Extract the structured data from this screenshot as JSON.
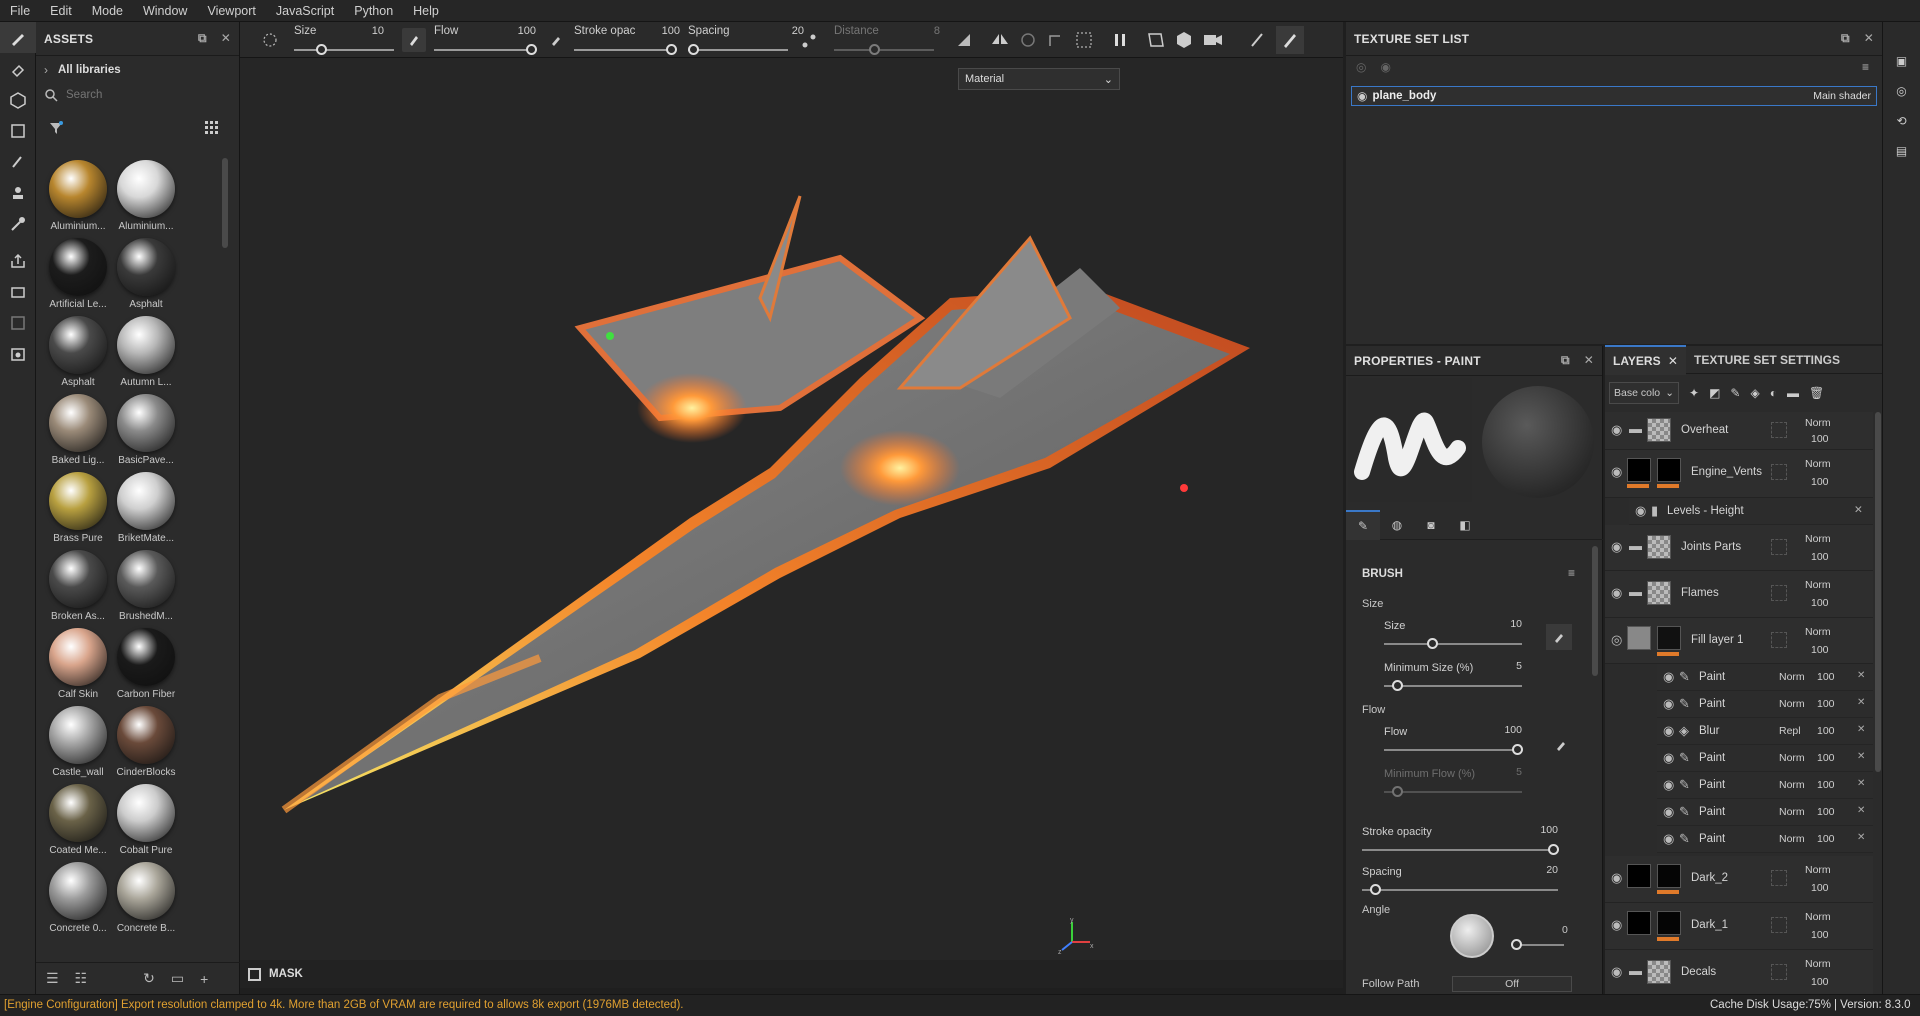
{
  "menu": [
    "File",
    "Edit",
    "Mode",
    "Window",
    "Viewport",
    "JavaScript",
    "Python",
    "Help"
  ],
  "assets": {
    "title": "ASSETS",
    "all_libraries": "All libraries",
    "search_placeholder": "Search",
    "materials": [
      {
        "name": "Aluminium...",
        "color": "#b8862e"
      },
      {
        "name": "Aluminium...",
        "color": "#d8d8d8"
      },
      {
        "name": "Artificial Le...",
        "color": "#1c1c1c"
      },
      {
        "name": "Asphalt",
        "color": "#3a3a3a"
      },
      {
        "name": "Asphalt",
        "color": "#4a4a4a"
      },
      {
        "name": "Autumn L...",
        "color": "#b8b8b8"
      },
      {
        "name": "Baked Lig...",
        "color": "#9a8a78"
      },
      {
        "name": "BasicPave...",
        "color": "#8a8a8a"
      },
      {
        "name": "Brass Pure",
        "color": "#b8a040"
      },
      {
        "name": "BriketMate...",
        "color": "#cfcfcf"
      },
      {
        "name": "Broken As...",
        "color": "#4a4a4a"
      },
      {
        "name": "BrushedM...",
        "color": "#5a5a5a"
      },
      {
        "name": "Calf Skin",
        "color": "#d9a58c"
      },
      {
        "name": "Carbon Fiber",
        "color": "#1a1a1a"
      },
      {
        "name": "Castle_wall",
        "color": "#a8a8a8"
      },
      {
        "name": "CinderBlocks",
        "color": "#6a4a3a"
      },
      {
        "name": "Coated Me...",
        "color": "#6a6248"
      },
      {
        "name": "Cobalt Pure",
        "color": "#cccccc"
      },
      {
        "name": "Concrete 0...",
        "color": "#9c9c9c"
      },
      {
        "name": "Concrete B...",
        "color": "#aaa69a"
      }
    ]
  },
  "toolbar": {
    "size_label": "Size",
    "size_value": "10",
    "flow_label": "Flow",
    "flow_value": "100",
    "stroke_label": "Stroke opac",
    "stroke_value": "100",
    "spacing_label": "Spacing",
    "spacing_value": "20",
    "distance_label": "Distance",
    "distance_value": "8"
  },
  "viewport": {
    "mode_select": "Material",
    "mask_label": "MASK"
  },
  "texture_set": {
    "title": "TEXTURE SET LIST",
    "item_name": "plane_body",
    "item_shader": "Main shader"
  },
  "properties": {
    "title": "PROPERTIES - PAINT",
    "brush_label": "BRUSH",
    "size_group": "Size",
    "size_label": "Size",
    "size_value": "10",
    "min_size_label": "Minimum Size (%)",
    "min_size_value": "5",
    "flow_group": "Flow",
    "flow_label": "Flow",
    "flow_value": "100",
    "min_flow_label": "Minimum Flow (%)",
    "min_flow_value": "5",
    "stroke_label": "Stroke opacity",
    "stroke_value": "100",
    "spacing_label": "Spacing",
    "spacing_value": "20",
    "angle_label": "Angle",
    "angle_value": "0",
    "follow_label": "Follow Path",
    "follow_value": "Off"
  },
  "layers": {
    "tab_layers": "LAYERS",
    "tab_settings": "TEXTURE SET SETTINGS",
    "channel": "Base colo",
    "items": [
      {
        "name": "Overheat",
        "blend": "Norm",
        "opacity": "100"
      },
      {
        "name": "Engine_Vents",
        "blend": "Norm",
        "opacity": "100"
      },
      {
        "name": "Levels - Height"
      },
      {
        "name": "Joints Parts",
        "blend": "Norm",
        "opacity": "100"
      },
      {
        "name": "Flames",
        "blend": "Norm",
        "opacity": "100"
      },
      {
        "name": "Fill layer 1",
        "blend": "Norm",
        "opacity": "100"
      },
      {
        "name": "Dark_2",
        "blend": "Norm",
        "opacity": "100"
      },
      {
        "name": "Dark_1",
        "blend": "Norm",
        "opacity": "100"
      },
      {
        "name": "Decals",
        "blend": "Norm",
        "opacity": "100"
      }
    ],
    "effects": [
      {
        "name": "Paint",
        "blend": "Norm",
        "opacity": "100"
      },
      {
        "name": "Paint",
        "blend": "Norm",
        "opacity": "100"
      },
      {
        "name": "Blur",
        "blend": "Repl",
        "opacity": "100"
      },
      {
        "name": "Paint",
        "blend": "Norm",
        "opacity": "100"
      },
      {
        "name": "Paint",
        "blend": "Norm",
        "opacity": "100"
      },
      {
        "name": "Paint",
        "blend": "Norm",
        "opacity": "100"
      },
      {
        "name": "Paint",
        "blend": "Norm",
        "opacity": "100"
      }
    ]
  },
  "status": {
    "message": "[Engine Configuration] Export resolution clamped to 4k. More than 2GB of VRAM are required to allows 8k export (1976MB detected).",
    "cache_label": "Cache Disk Usage:",
    "cache_value": "75%",
    "version": "| Version: 8.3.0"
  },
  "colors": {
    "accent_orange": "#e07a2a",
    "warning": "#e0a030",
    "selection": "#3a78c8"
  }
}
